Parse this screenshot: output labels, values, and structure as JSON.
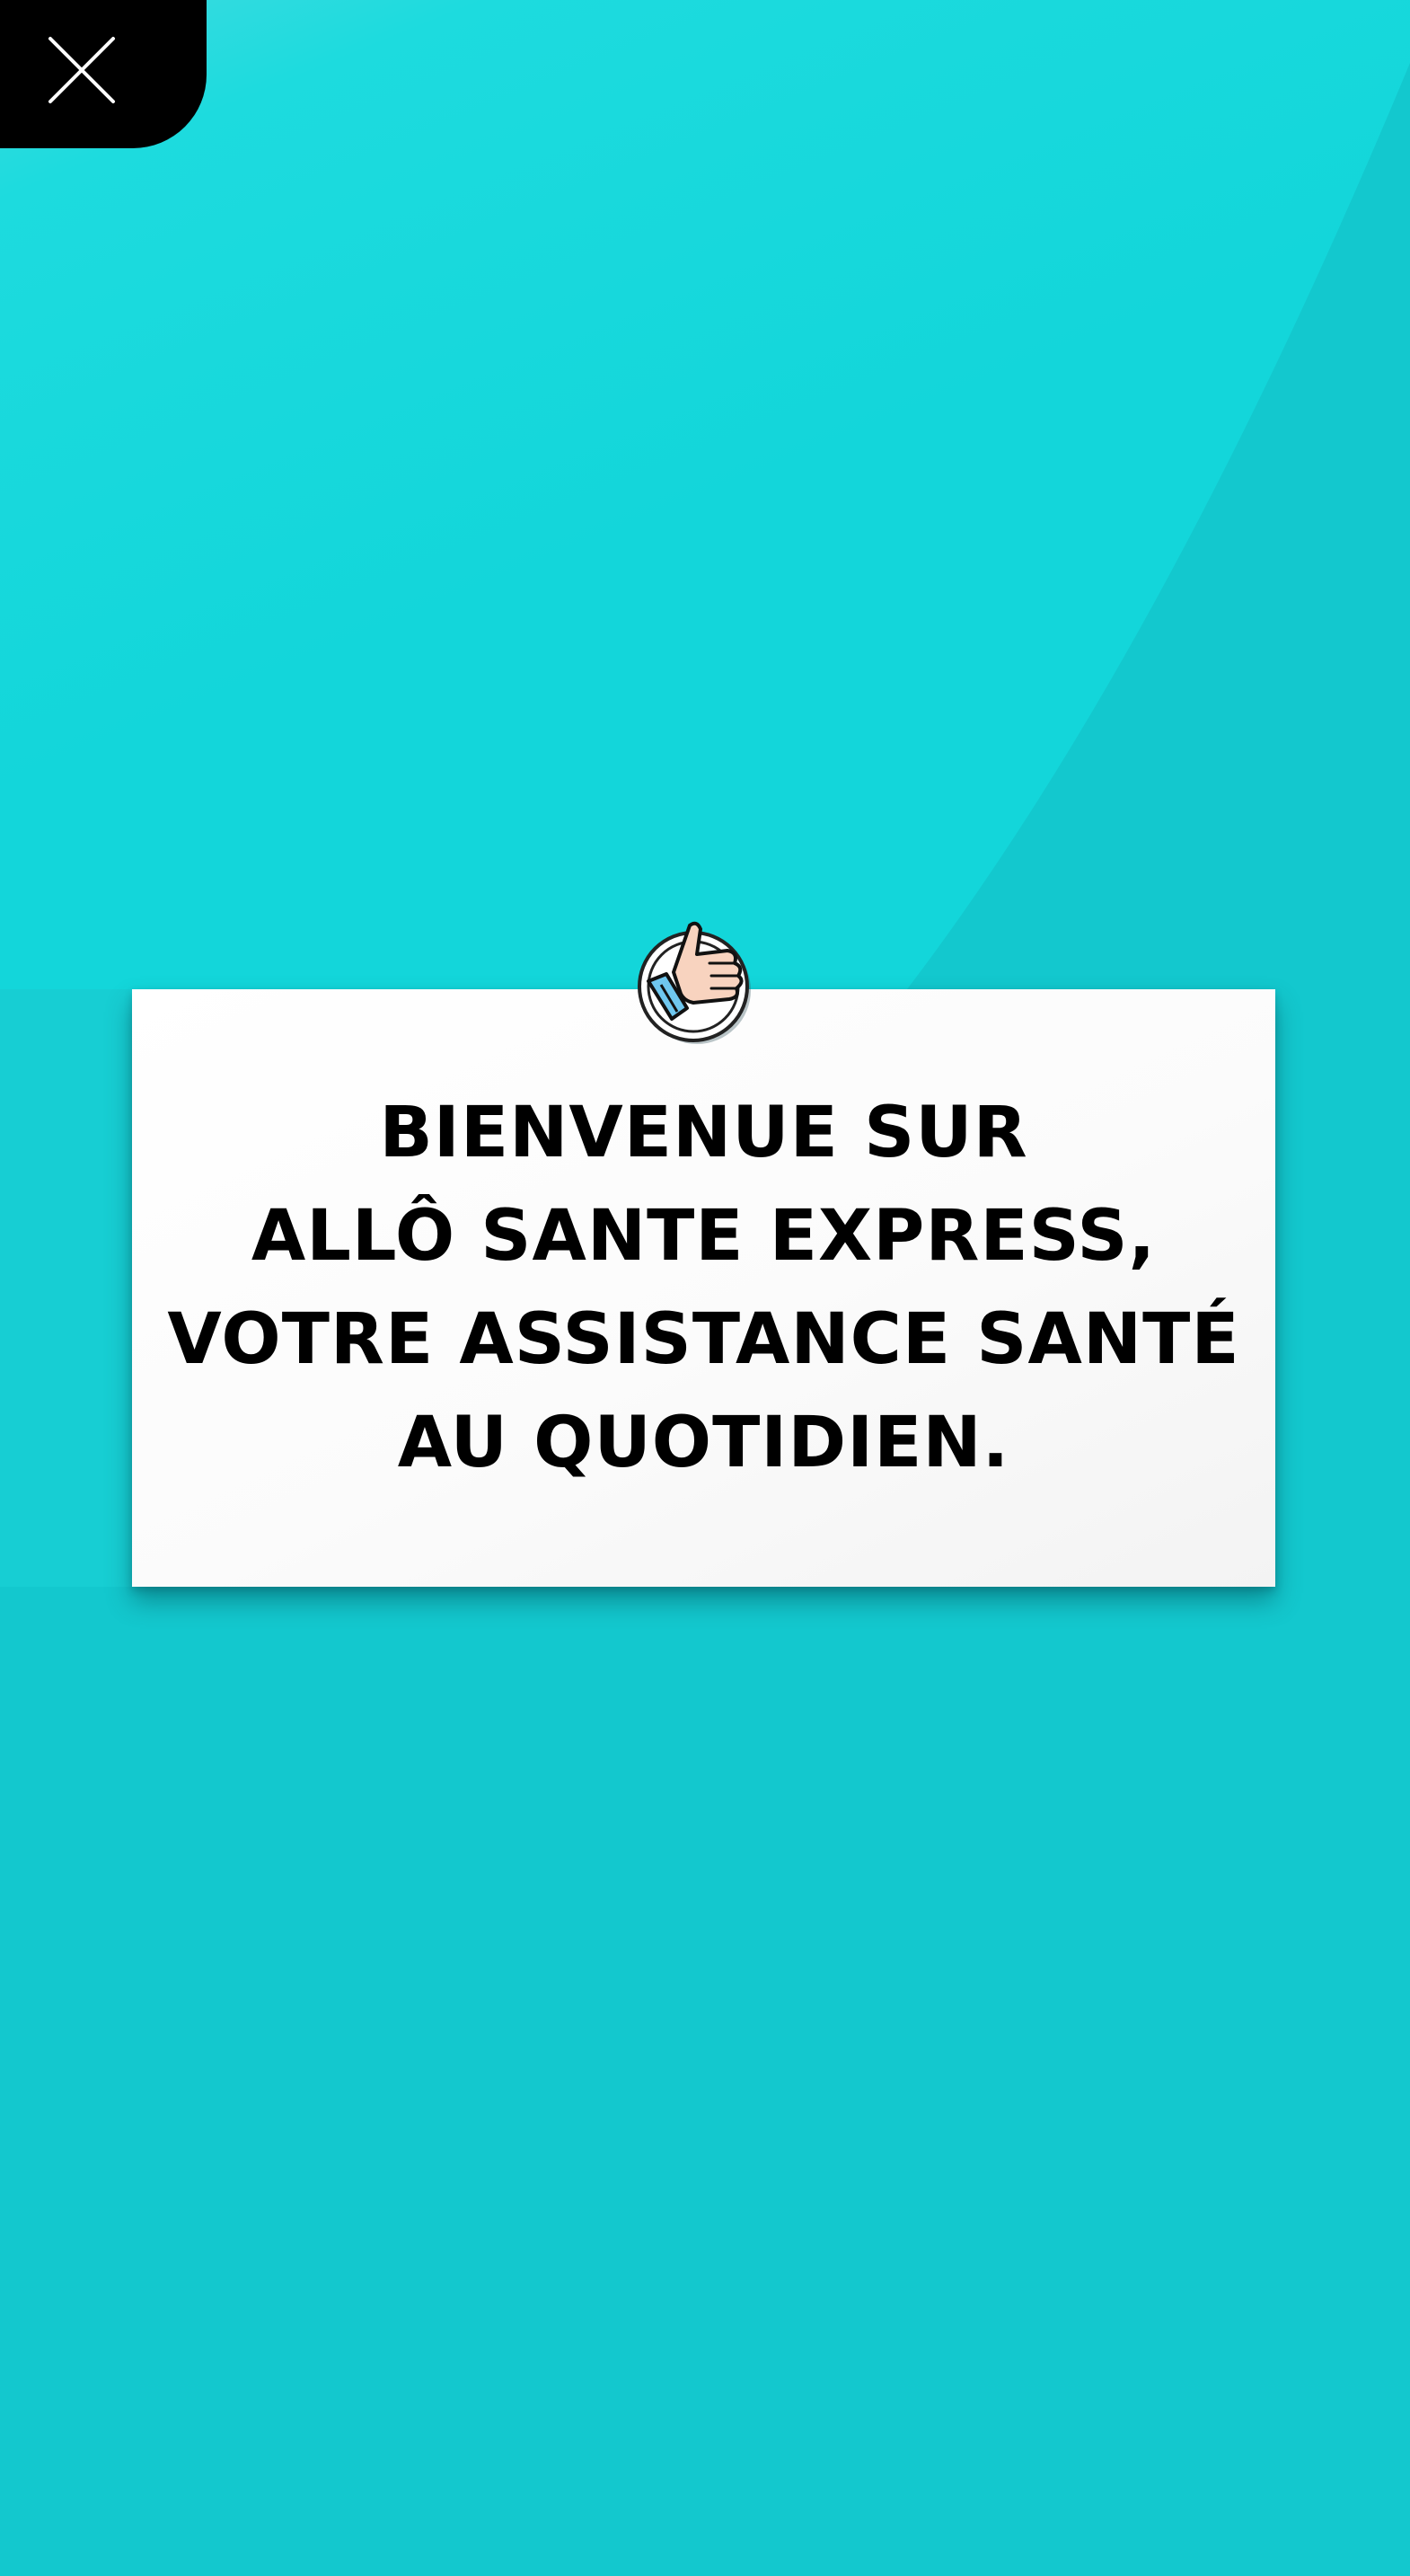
{
  "colors": {
    "background": "#13c8ce",
    "background_light": "#1ddbde",
    "card": "#ffffff",
    "close_button": "#000000",
    "text": "#000000"
  },
  "close_button": {
    "icon": "close-icon"
  },
  "welcome_card": {
    "badge_icon": "thumbs-up-icon",
    "lines": [
      "BIENVENUE SUR",
      "ALLÔ SANTE EXPRESS,",
      "VOTRE ASSISTANCE SANTÉ",
      "AU QUOTIDIEN."
    ]
  }
}
